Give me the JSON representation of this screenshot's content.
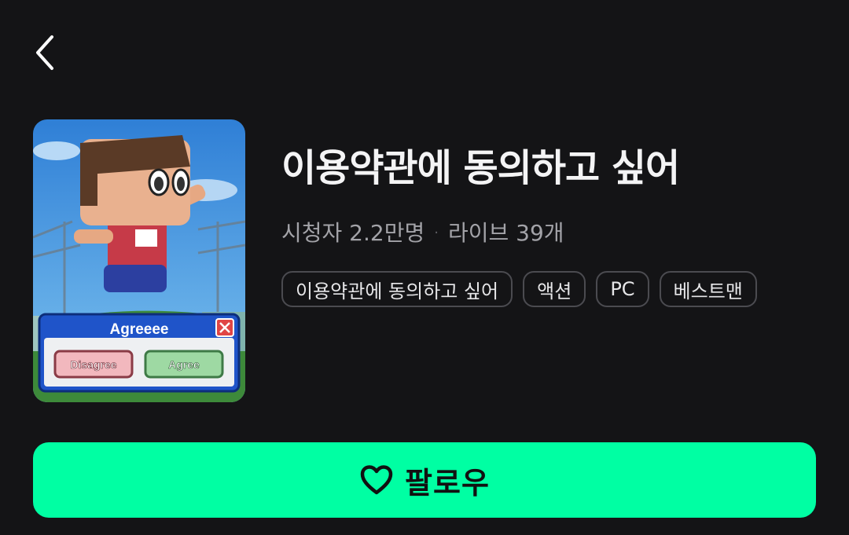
{
  "header": {
    "back_icon": "chevron-left-icon"
  },
  "game": {
    "title": "이용약관에 동의하고 싶어",
    "viewers": "시청자 2.2만명",
    "separator": "·",
    "lives": "라이브 39개",
    "tags": [
      "이용약관에 동의하고 싶어",
      "액션",
      "PC",
      "베스트맨"
    ],
    "thumbnail": {
      "dialog_title": "Agreeee",
      "disagree_label": "Disagree",
      "agree_label": "Agree"
    }
  },
  "follow": {
    "label": "팔로우",
    "icon": "heart-outline-icon",
    "color": "#00ffa3"
  }
}
